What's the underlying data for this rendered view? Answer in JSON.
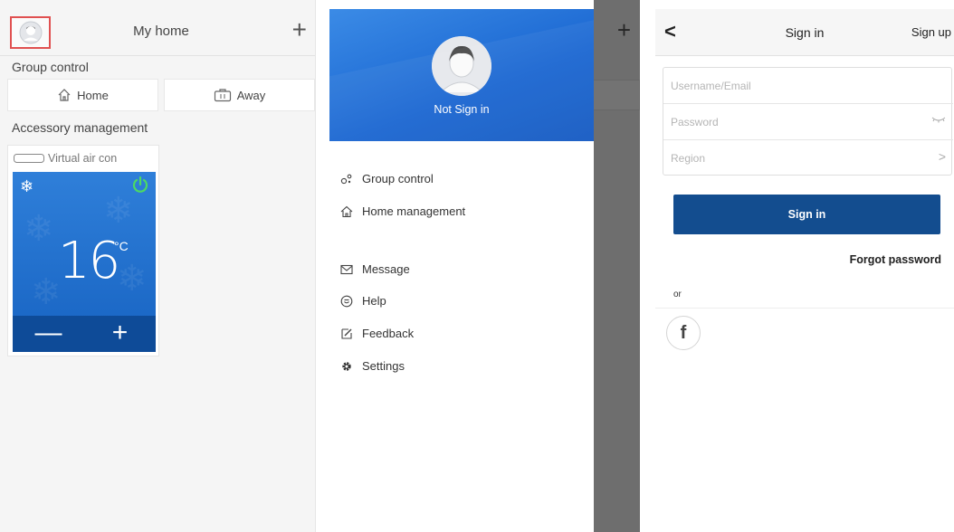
{
  "home": {
    "title": "My home",
    "add_icon": "plus-icon",
    "group_control_label": "Group control",
    "group_buttons": [
      {
        "label": "Home",
        "icon": "house-icon"
      },
      {
        "label": "Away",
        "icon": "suitcase-icon"
      }
    ],
    "accessory_label": "Accessory management",
    "device": {
      "name": "Virtual air con",
      "mode_icon": "snowflake-icon",
      "power_icon": "power-icon",
      "power_color": "#4cd964",
      "temperature": "16",
      "unit": "°C",
      "decrease": "—",
      "increase": "+"
    }
  },
  "drawer": {
    "status": "Not Sign in",
    "menu": [
      {
        "label": "Group control",
        "icon": "group-icon"
      },
      {
        "label": "Home management",
        "icon": "house-icon"
      },
      {
        "label": "Message",
        "icon": "envelope-icon"
      },
      {
        "label": "Help",
        "icon": "smiley-icon"
      },
      {
        "label": "Feedback",
        "icon": "edit-icon"
      },
      {
        "label": "Settings",
        "icon": "gear-icon"
      }
    ],
    "background_plus": "+"
  },
  "signin": {
    "back_icon": "chevron-left-icon",
    "title": "Sign in",
    "signup_label": "Sign up",
    "username_placeholder": "Username/Email",
    "password_placeholder": "Password",
    "region_placeholder": "Region",
    "button_label": "Sign in",
    "forgot_label": "Forgot password",
    "or_label": "or",
    "social": "f",
    "brand_color": "#134d8f"
  }
}
